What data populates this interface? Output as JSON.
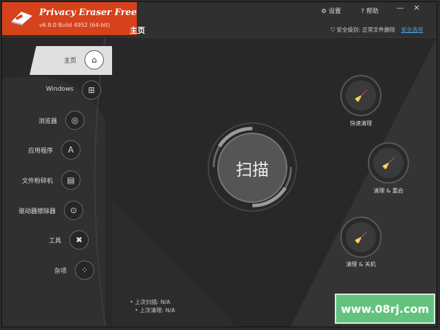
{
  "app": {
    "title": "Privacy Eraser Free",
    "version": "v6.8.0 Build 4952 (64-bit)",
    "accent_color": "#d6421c"
  },
  "top_links": {
    "settings": "设置",
    "help": "帮助"
  },
  "window_buttons": {
    "minimize": "—",
    "close": "✕"
  },
  "header": {
    "page_title": "主页",
    "security_label": "安全级别: 正常文件删除",
    "security_link": "安全选项"
  },
  "sidebar": {
    "items": [
      {
        "label": "主页",
        "icon": "home-icon",
        "glyph": "⌂"
      },
      {
        "label": "Windows",
        "icon": "windows-icon",
        "glyph": "⊞"
      },
      {
        "label": "浏览器",
        "icon": "globe-icon",
        "glyph": "◎"
      },
      {
        "label": "应用程序",
        "icon": "apps-icon",
        "glyph": "A"
      },
      {
        "label": "文件粉碎机",
        "icon": "shredder-icon",
        "glyph": "▤"
      },
      {
        "label": "驱动器擦除器",
        "icon": "drive-wiper-icon",
        "glyph": "⊙"
      },
      {
        "label": "工具",
        "icon": "tools-icon",
        "glyph": "✖"
      },
      {
        "label": "杂项",
        "icon": "misc-icon",
        "glyph": "⁘"
      }
    ]
  },
  "scan": {
    "label": "扫描"
  },
  "actions": [
    {
      "label": "快速清理",
      "icon": "quick-clean-icon"
    },
    {
      "label": "清理 & 重启",
      "icon": "clean-restart-icon"
    },
    {
      "label": "清理 & 关机",
      "icon": "clean-shutdown-icon"
    }
  ],
  "status": {
    "last_scan": "上次扫描:  N/A",
    "last_clean": "上次清理:  N/A"
  },
  "watermark": "www.08rj.com"
}
